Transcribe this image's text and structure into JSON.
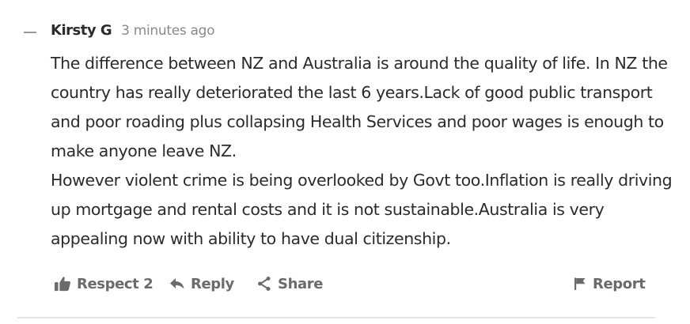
{
  "comment": {
    "author": "Kirsty G",
    "timestamp": "3 minutes ago",
    "paragraphs": [
      "The difference between NZ and Australia is around the quality of life. In NZ the country has really deteriorated the last 6 years.Lack of good public transport and poor roading plus collapsing Health Services and poor wages is enough to make anyone leave NZ.",
      "However violent crime is being overlooked by Govt too.Inflation is really driving up mortgage and rental costs and it is not sustainable.Australia is very appealing now with ability to have dual citizenship."
    ]
  },
  "actions": {
    "respect_label": "Respect 2",
    "reply_label": "Reply",
    "share_label": "Share",
    "report_label": "Report"
  },
  "icons": {
    "collapse": "minus-icon",
    "respect": "thumbs-up-icon",
    "reply": "reply-arrow-icon",
    "share": "share-icon",
    "report": "flag-icon"
  },
  "colors": {
    "text": "#2b2b2b",
    "muted": "#8a8a8a",
    "action": "#6b6b6b",
    "divider": "#e3e3e3"
  }
}
